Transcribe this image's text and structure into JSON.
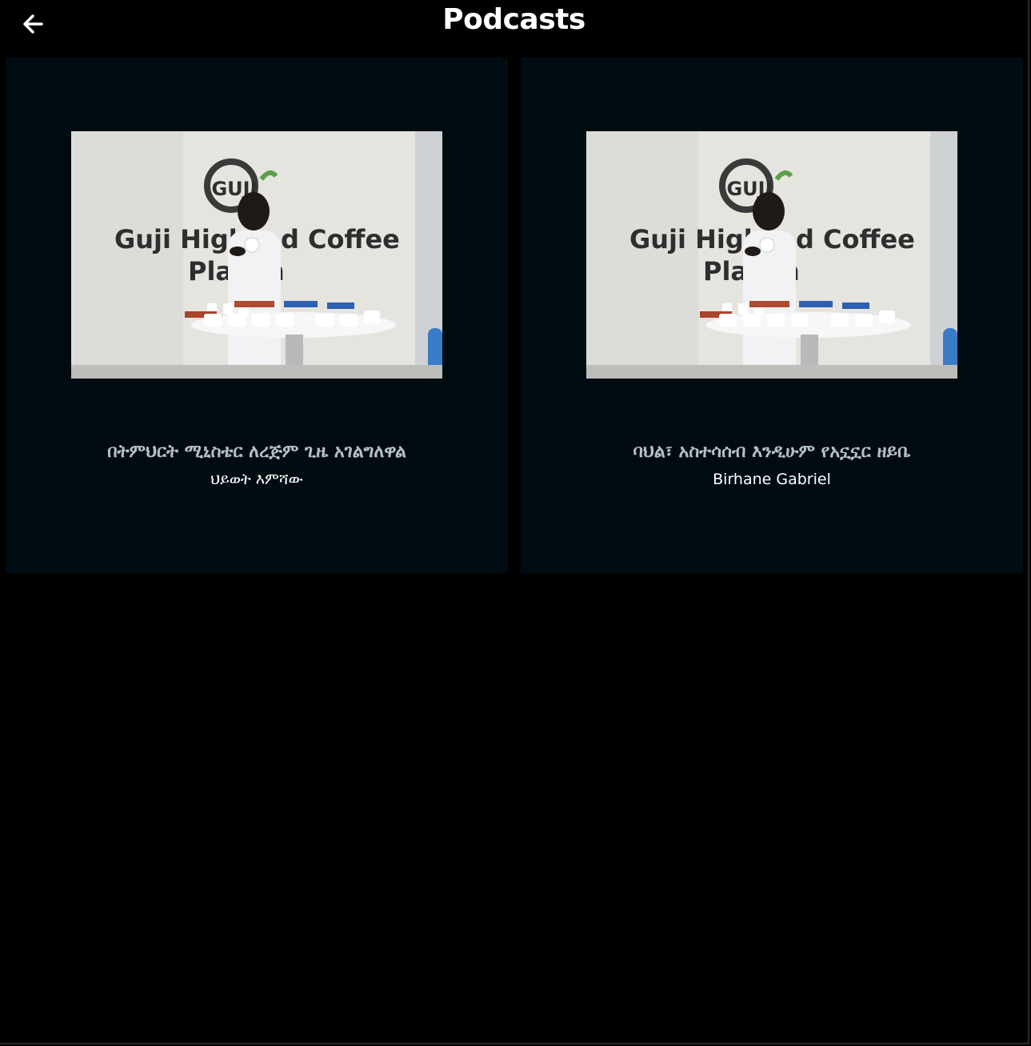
{
  "header": {
    "title": "Podcasts",
    "back_icon": "arrow-left-icon"
  },
  "podcasts": [
    {
      "title": "በትምህርት ሚኒስቴር ለረጅም ጊዜ አገልግለዋል",
      "author": "ህይወት እምሻው",
      "thumbnail": {
        "sign_line1": "Guji High",
        "sign_line1b": "d Coffee",
        "sign_line2a": "Pla",
        "sign_line2b": "n",
        "logo_text": "GUJI"
      }
    },
    {
      "title": "ባህል፣ አስተሳሰብ እንዲሁም የአኗኗር ዘይቤ",
      "author": "Birhane Gabriel",
      "thumbnail": {
        "sign_line1": "Guji High",
        "sign_line1b": "d Coffee",
        "sign_line2a": "Pla",
        "sign_line2b": "n",
        "logo_text": "GUJI"
      }
    }
  ],
  "colors": {
    "background": "#000000",
    "card": "#010c12",
    "title_text": "#b9bec3",
    "author_text": "#ffffff"
  }
}
